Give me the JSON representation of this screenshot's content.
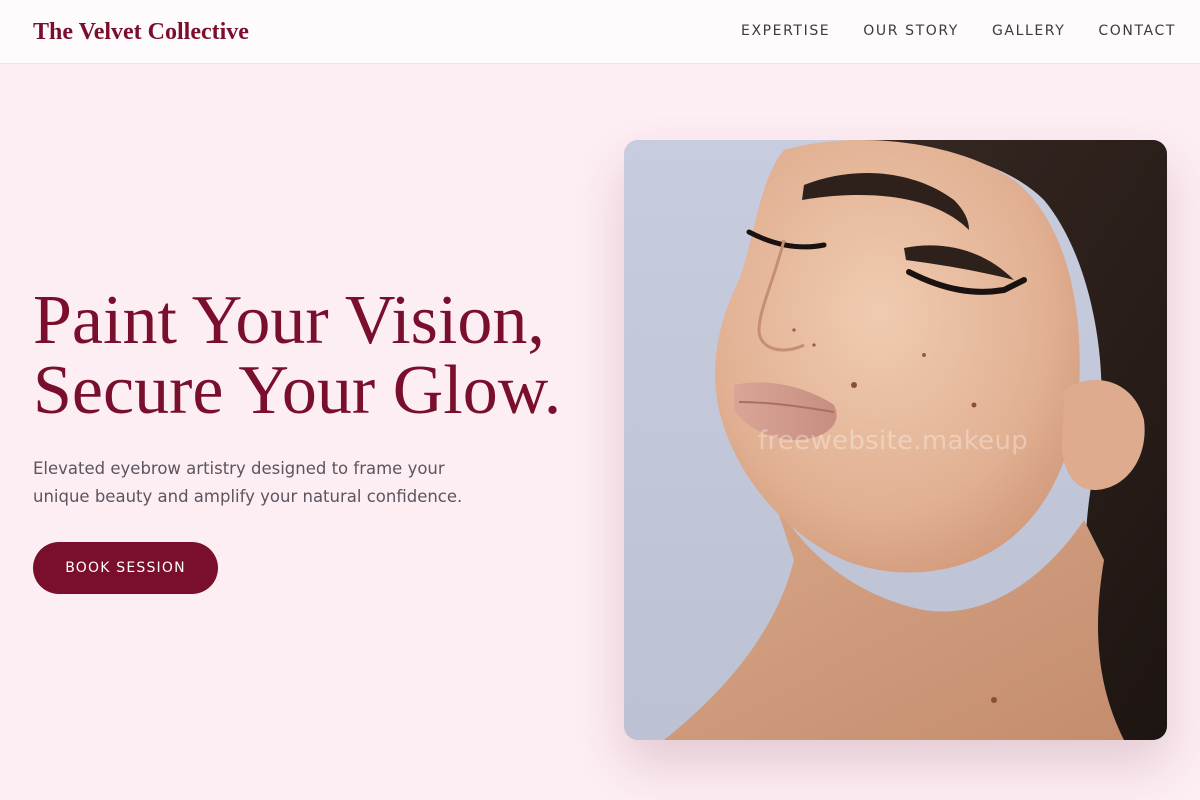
{
  "header": {
    "brand": "The Velvet Collective",
    "nav": [
      {
        "label": "EXPERTISE"
      },
      {
        "label": "OUR STORY"
      },
      {
        "label": "GALLERY"
      },
      {
        "label": "CONTACT"
      }
    ]
  },
  "hero": {
    "title_lines": [
      "Paint Your Vision,",
      "Secure Your Glow."
    ],
    "subtitle_lines": [
      "Elevated eyebrow artistry designed to frame your",
      "unique beauty and amplify your natural confidence."
    ],
    "cta_label": "BOOK SESSION",
    "image": {
      "subject": "close-up portrait of a woman with eyes closed, defined eyebrows and winged eyeliner",
      "watermark": "freewebsite.makeup"
    }
  },
  "colors": {
    "background": "#fdeef3",
    "header_background": "#fefbfc",
    "brand": "#7a0f2d",
    "nav_text": "#3a3a3f",
    "body_text": "#5a5560",
    "button": "#7a0f2d",
    "button_text": "#ffffff"
  }
}
